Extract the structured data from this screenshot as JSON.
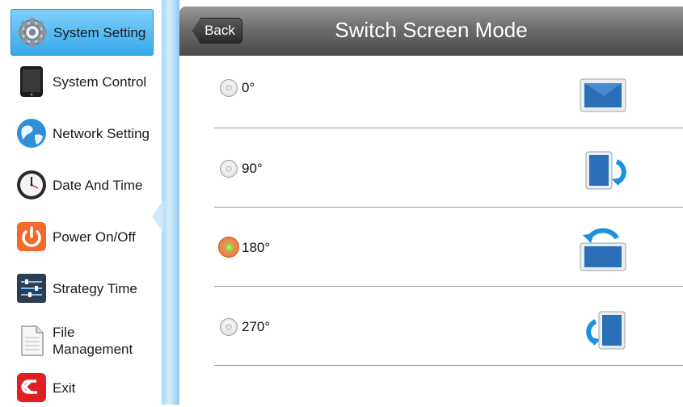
{
  "sidebar": {
    "items": [
      {
        "label": "System Setting",
        "icon": "gear-icon",
        "active": true
      },
      {
        "label": "System Control",
        "icon": "tablet-icon",
        "active": false
      },
      {
        "label": "Network Setting",
        "icon": "globe-icon",
        "active": false
      },
      {
        "label": "Date And Time",
        "icon": "clock-icon",
        "active": false
      },
      {
        "label": "Power On/Off",
        "icon": "power-icon",
        "active": false
      },
      {
        "label": "Strategy Time",
        "icon": "sliders-icon",
        "active": false
      },
      {
        "label_line1": "File",
        "label_line2": "Management",
        "icon": "document-icon",
        "active": false
      },
      {
        "label": "Exit",
        "icon": "exit-icon",
        "active": false
      }
    ]
  },
  "header": {
    "back_label": "Back",
    "title": "Switch Screen Mode"
  },
  "options": [
    {
      "label": "0°",
      "selected": false,
      "icon": "landscape-screen-icon"
    },
    {
      "label": "90°",
      "selected": false,
      "icon": "portrait-rotate-right-icon"
    },
    {
      "label": "180°",
      "selected": true,
      "icon": "landscape-rotate-top-icon"
    },
    {
      "label": "270°",
      "selected": false,
      "icon": "portrait-rotate-left-icon"
    }
  ],
  "colors": {
    "accent": "#36a8ec",
    "header": "#6c6c6c",
    "selected_radio": "#e0762e"
  }
}
